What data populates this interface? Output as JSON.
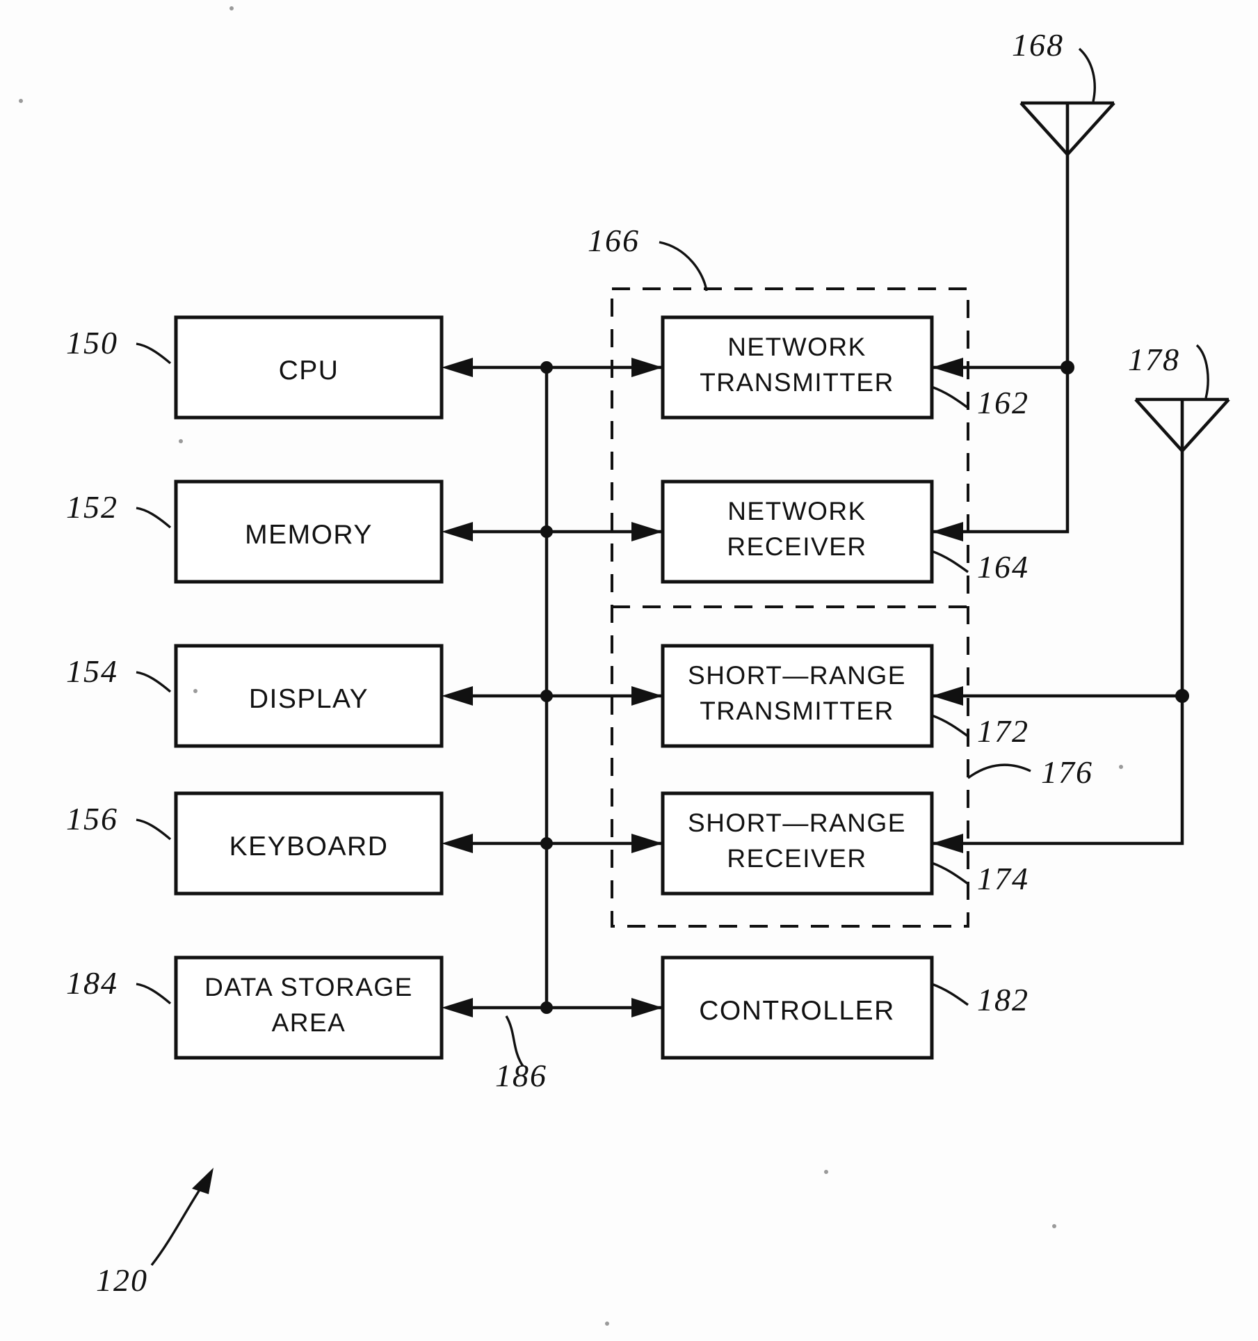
{
  "figure": {
    "figure_ref": "120",
    "bus_ref": "186",
    "wireless_module_ref": "166",
    "short_range_module_ref": "176"
  },
  "blocks": [
    {
      "id": "cpu",
      "label_lines": [
        "CPU"
      ],
      "ref": "150",
      "ref_side": "left"
    },
    {
      "id": "memory",
      "label_lines": [
        "MEMORY"
      ],
      "ref": "152",
      "ref_side": "left"
    },
    {
      "id": "display",
      "label_lines": [
        "DISPLAY"
      ],
      "ref": "154",
      "ref_side": "left"
    },
    {
      "id": "keyboard",
      "label_lines": [
        "KEYBOARD"
      ],
      "ref": "156",
      "ref_side": "left"
    },
    {
      "id": "data-storage",
      "label_lines": [
        "DATA  STORAGE",
        "AREA"
      ],
      "ref": "184",
      "ref_side": "left"
    },
    {
      "id": "network-transmitter",
      "label_lines": [
        "NETWORK",
        "TRANSMITTER"
      ],
      "ref": "162",
      "ref_side": "right"
    },
    {
      "id": "network-receiver",
      "label_lines": [
        "NETWORK",
        "RECEIVER"
      ],
      "ref": "164",
      "ref_side": "right"
    },
    {
      "id": "short-range-transmitter",
      "label_lines": [
        "SHORT—RANGE",
        "TRANSMITTER"
      ],
      "ref": "172",
      "ref_side": "right"
    },
    {
      "id": "short-range-receiver",
      "label_lines": [
        "SHORT—RANGE",
        "RECEIVER"
      ],
      "ref": "174",
      "ref_side": "right"
    },
    {
      "id": "controller",
      "label_lines": [
        "CONTROLLER"
      ],
      "ref": "182",
      "ref_side": "right"
    }
  ],
  "antennas": [
    {
      "id": "network-antenna",
      "ref": "168"
    },
    {
      "id": "short-range-antenna",
      "ref": "178"
    }
  ],
  "labels": {
    "cpu": "CPU",
    "memory": "MEMORY",
    "display": "DISPLAY",
    "keyboard": "KEYBOARD",
    "data_storage_line1": "DATA  STORAGE",
    "data_storage_line2": "AREA",
    "network_transmitter_line1": "NETWORK",
    "network_transmitter_line2": "TRANSMITTER",
    "network_receiver_line1": "NETWORK",
    "network_receiver_line2": "RECEIVER",
    "short_range_transmitter_line1": "SHORT—RANGE",
    "short_range_transmitter_line2": "TRANSMITTER",
    "short_range_receiver_line1": "SHORT—RANGE",
    "short_range_receiver_line2": "RECEIVER",
    "controller": "CONTROLLER"
  },
  "refs": {
    "r150": "150",
    "r152": "152",
    "r154": "154",
    "r156": "156",
    "r184": "184",
    "r162": "162",
    "r164": "164",
    "r172": "172",
    "r174": "174",
    "r182": "182",
    "r166": "166",
    "r176": "176",
    "r168": "168",
    "r178": "178",
    "r186": "186",
    "r120": "120"
  },
  "colors": {
    "ink": "#111111",
    "paper": "#fdfdfd"
  }
}
